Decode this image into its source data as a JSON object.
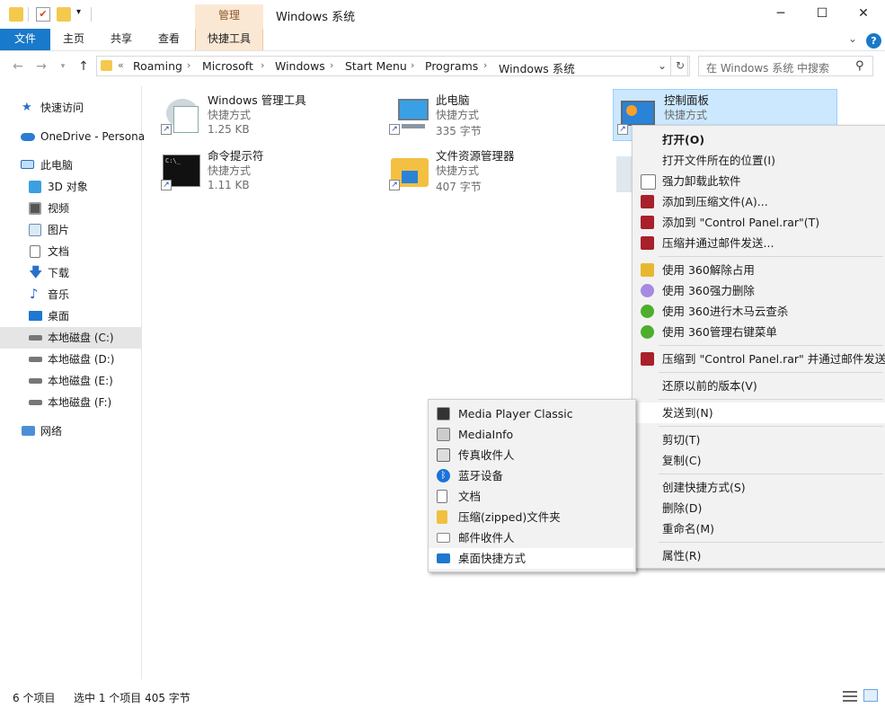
{
  "window": {
    "title": "Windows 系统",
    "context_tab_header": "管理",
    "controls": {
      "minimize": "─",
      "maximize": "☐",
      "close": "✕"
    }
  },
  "ribbon": {
    "tabs": [
      "文件",
      "主页",
      "共享",
      "查看",
      "快捷工具"
    ],
    "help": "?"
  },
  "address": {
    "overflow": "«",
    "crumbs": [
      "Roaming",
      "Microsoft",
      "Windows",
      "Start Menu",
      "Programs",
      "Windows 系统"
    ],
    "search_placeholder": "在 Windows 系统 中搜索"
  },
  "nav": {
    "quick_access": "快速访问",
    "onedrive": "OneDrive - Persona",
    "this_pc": "此电脑",
    "items": [
      "3D 对象",
      "视频",
      "图片",
      "文档",
      "下载",
      "音乐",
      "桌面",
      "本地磁盘 (C:)",
      "本地磁盘 (D:)",
      "本地磁盘 (E:)",
      "本地磁盘 (F:)"
    ],
    "network": "网络"
  },
  "files": [
    {
      "name": "Windows 管理工具",
      "type": "快捷方式",
      "size": "1.25 KB"
    },
    {
      "name": "此电脑",
      "type": "快捷方式",
      "size": "335 字节"
    },
    {
      "name": "控制面板",
      "type": "快捷方式",
      "size": ""
    },
    {
      "name": "命令提示符",
      "type": "快捷方式",
      "size": "1.11 KB"
    },
    {
      "name": "文件资源管理器",
      "type": "快捷方式",
      "size": "407 字节"
    }
  ],
  "status": {
    "count": "6 个项目",
    "selection": "选中 1 个项目  405 字节"
  },
  "context_menu": {
    "items": [
      "打开(O)",
      "打开文件所在的位置(I)",
      "强力卸载此软件",
      "添加到压缩文件(A)...",
      "添加到 \"Control Panel.rar\"(T)",
      "压缩并通过邮件发送...",
      "使用 360解除占用",
      "使用 360强力删除",
      "使用 360进行木马云查杀",
      "使用 360管理右键菜单",
      "压缩到 \"Control Panel.rar\" 并通过邮件发送",
      "还原以前的版本(V)",
      "发送到(N)",
      "剪切(T)",
      "复制(C)",
      "创建快捷方式(S)",
      "删除(D)",
      "重命名(M)",
      "属性(R)"
    ],
    "submenu_arrow": "›"
  },
  "sendto_menu": {
    "items": [
      "Media Player Classic",
      "MediaInfo",
      "传真收件人",
      "蓝牙设备",
      "文档",
      "压缩(zipped)文件夹",
      "邮件收件人",
      "桌面快捷方式"
    ]
  },
  "colors": {
    "accent": "#1979ca",
    "selection": "#cce8ff",
    "context_tab": "#fbe8d4"
  }
}
